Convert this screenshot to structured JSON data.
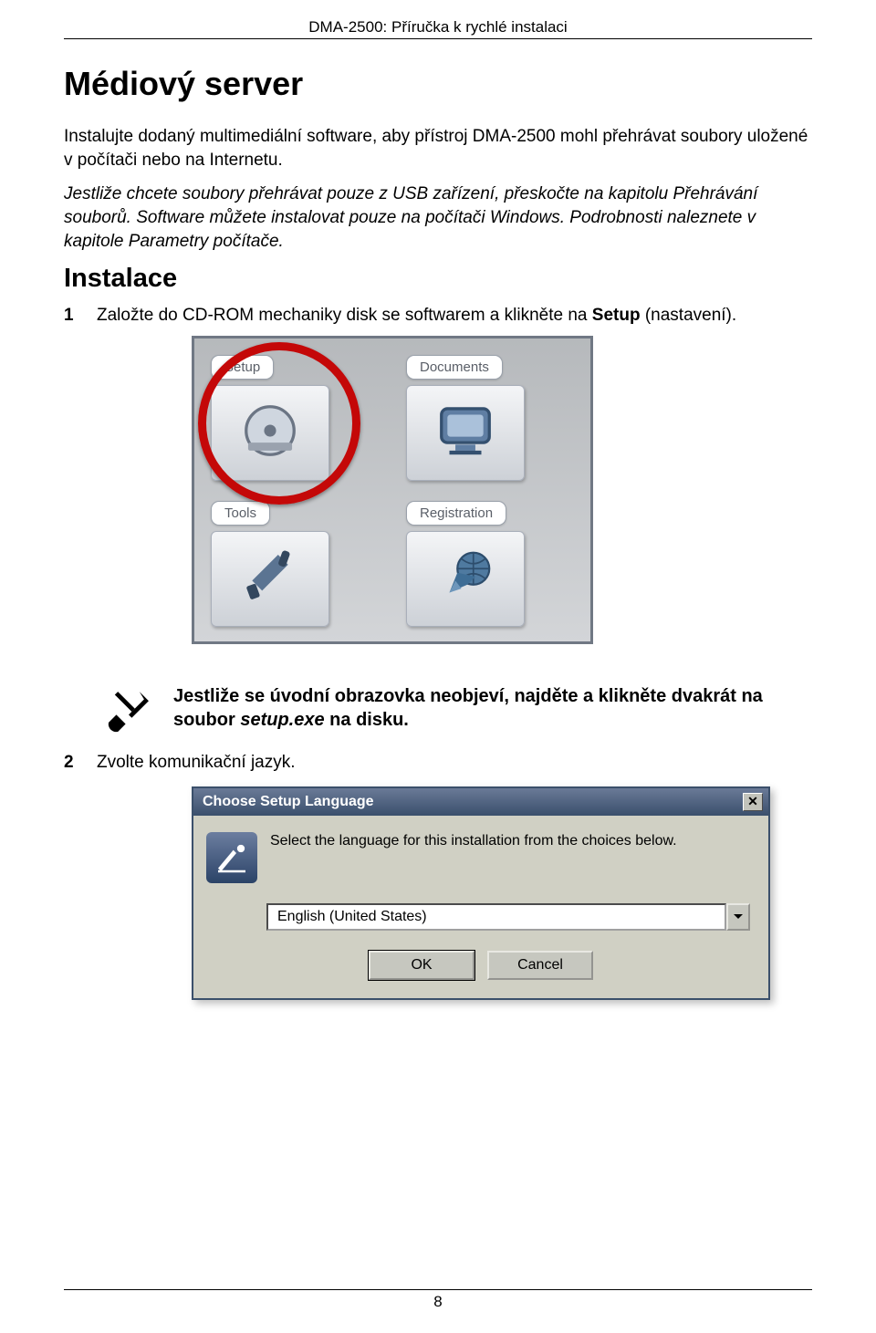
{
  "header": "DMA-2500: Příručka k rychlé instalaci",
  "h1": "Médiový server",
  "para1": "Instalujte dodaný multimediální software, aby přístroj DMA-2500 mohl přehrávat soubory uložené v počítači nebo na Internetu.",
  "para2": "Jestliže chcete soubory přehrávat pouze z USB zařízení, přeskočte na kapitolu Přehrávání souborů. Software můžete instalovat pouze na počítači Windows. Podrobnosti naleznete v kapitole Parametry počítače.",
  "h2": "Instalace",
  "step1": {
    "num": "1",
    "text_before": "Založte do CD-ROM mechaniky disk se softwarem a klikněte na ",
    "bold": "Setup",
    "after": " (nastavení)."
  },
  "cdmenu": {
    "setup": "Setup",
    "documents": "Documents",
    "tools": "Tools",
    "registration": "Registration"
  },
  "note": {
    "line_a": "Jestliže se úvodní obrazovka neobjeví, najděte a klikněte dvakrát na soubor ",
    "file": "setup.exe",
    "line_b": " na disku."
  },
  "step2": {
    "num": "2",
    "text": "Zvolte komunikační jazyk."
  },
  "dialog": {
    "title": "Choose Setup Language",
    "body": "Select the language for this installation from the choices below.",
    "value": "English (United States)",
    "ok": "OK",
    "cancel": "Cancel",
    "close_glyph": "✕"
  },
  "page_number": "8"
}
